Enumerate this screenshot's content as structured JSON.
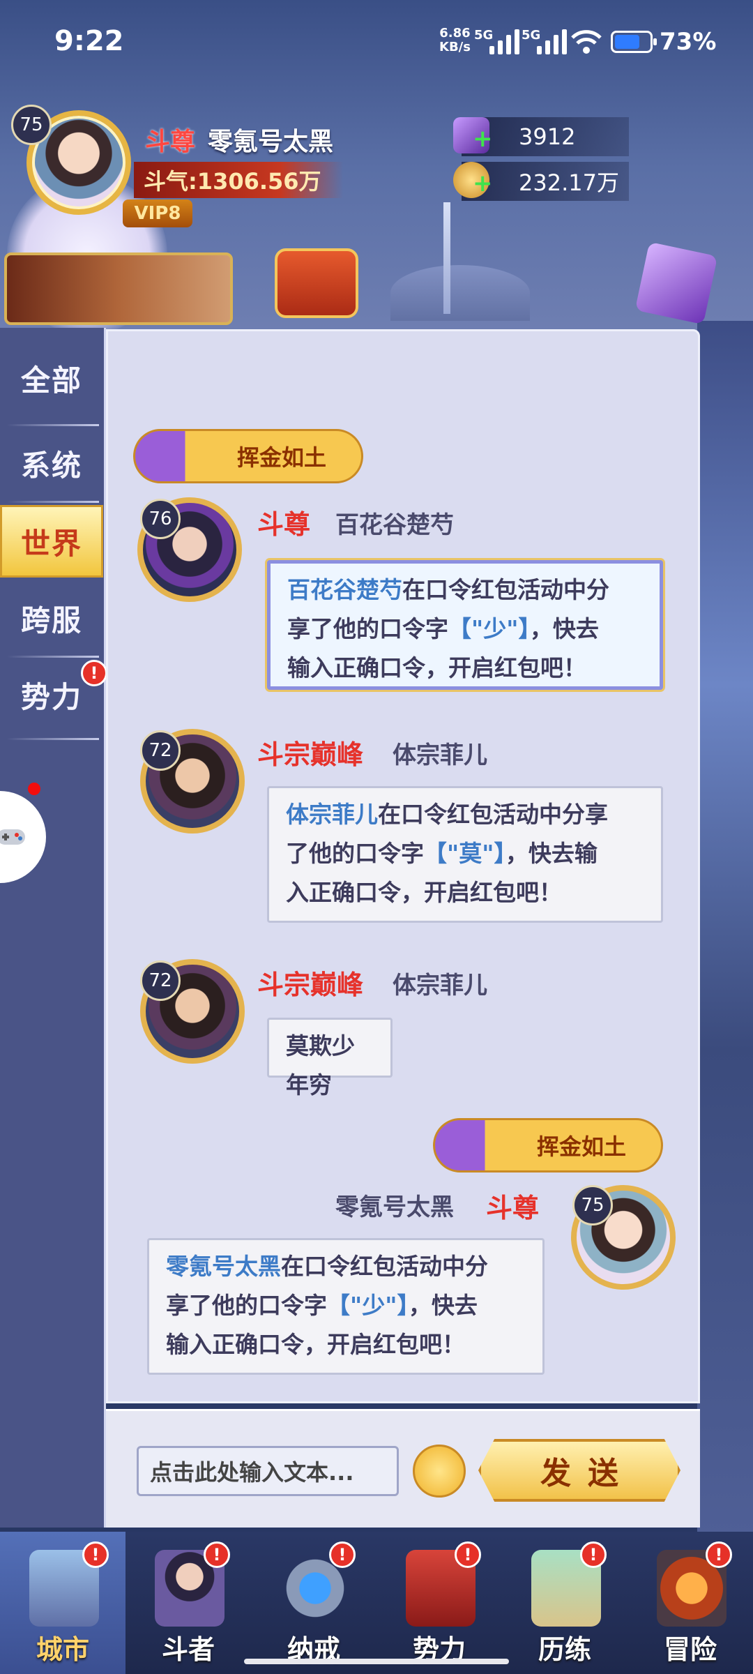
{
  "status_bar": {
    "time": "9:22",
    "net_speed": "6.86",
    "net_unit": "KB/s",
    "sim1": "5G",
    "sim2": "5G",
    "battery_pct": "73%",
    "battery_level": 0.73
  },
  "player": {
    "level": "75",
    "rank": "斗尊",
    "name": "零氪号太黑",
    "power": "斗气:1306.56万",
    "vip": "VIP8",
    "crystals": "3912",
    "gold": "232.17万"
  },
  "tabs": [
    {
      "label": "全部"
    },
    {
      "label": "系统"
    },
    {
      "label": "世界",
      "active": true
    },
    {
      "label": "跨服"
    },
    {
      "label": "势力",
      "alert": "!"
    }
  ],
  "messages": [
    {
      "title": "挥金如土",
      "level": "76",
      "rank": "斗尊",
      "name": "百花谷楚芍",
      "line1_name": "百花谷楚芍",
      "line1_rest": "在口令红包活动中分",
      "line2_pre": "享了他的口令字",
      "line2_word": "【\"少\"】",
      "line2_post": "，快去",
      "line3": "输入正确口令，开启红包吧！"
    },
    {
      "level": "72",
      "rank": "斗宗巅峰",
      "name": "体宗菲儿",
      "line1_name": "体宗菲儿",
      "line1_rest": "在口令红包活动中分享",
      "line2_pre": "了他的口令字",
      "line2_word": "【\"莫\"】",
      "line2_post": "，快去输",
      "line3": "入正确口令，开启红包吧！"
    },
    {
      "level": "72",
      "rank": "斗宗巅峰",
      "name": "体宗菲儿",
      "text": "莫欺少年穷"
    },
    {
      "title": "挥金如土",
      "level": "75",
      "rank": "斗尊",
      "name": "零氪号太黑",
      "line1_name": "零氪号太黑",
      "line1_rest": "在口令红包活动中分",
      "line2_pre": "享了他的口令字",
      "line2_word": "【\"少\"】",
      "line2_post": "，快去",
      "line3": "输入正确口令，开启红包吧！"
    }
  ],
  "input": {
    "placeholder": "点击此处输入文本...",
    "send_label": "发送"
  },
  "bottom_nav": [
    {
      "label": "城市",
      "alert": "!",
      "active": true
    },
    {
      "label": "斗者",
      "alert": "!"
    },
    {
      "label": "纳戒",
      "alert": "!"
    },
    {
      "label": "势力",
      "alert": "!"
    },
    {
      "label": "历练",
      "alert": "!"
    },
    {
      "label": "冒险",
      "alert": "!"
    }
  ],
  "colors": {
    "rank_red": "#e6322b",
    "name_blue": "#3d7bc7",
    "gold": "#f2c24a",
    "panel": "#dadcf0"
  }
}
